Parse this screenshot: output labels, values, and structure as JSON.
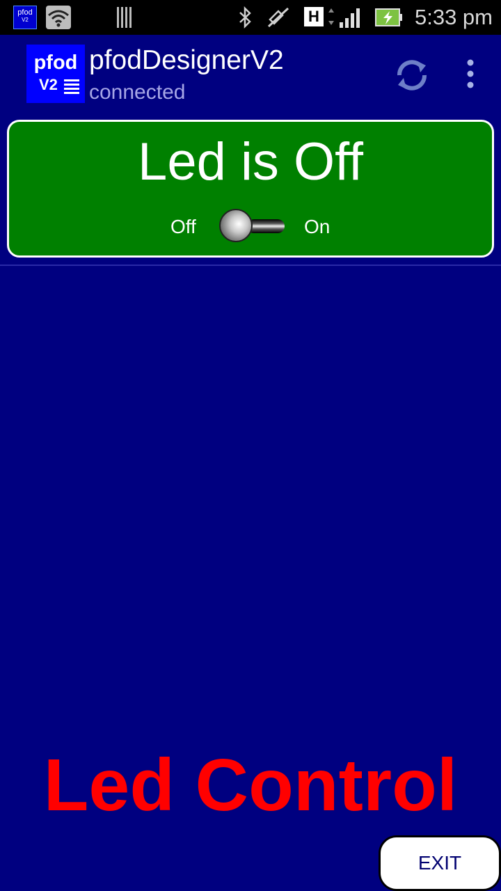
{
  "status_bar": {
    "notification_app_text": "pfod",
    "notification_app_subtext": "V2",
    "icons": [
      "pfod-app-icon",
      "wifi-icon",
      "barcode-icon",
      "bluetooth-icon",
      "vibrate-off-icon",
      "hspa-icon",
      "signal-icon",
      "battery-charging-icon"
    ],
    "network_type": "H",
    "time": "5:33 pm"
  },
  "action_bar": {
    "logo_text": "pfod",
    "logo_version": "V2",
    "title": "pfodDesignerV2",
    "subtitle": "connected",
    "refresh_icon": "refresh-icon",
    "overflow_icon": "overflow-menu-icon"
  },
  "led_card": {
    "status_text": "Led is Off",
    "toggle_off_label": "Off",
    "toggle_on_label": "On",
    "toggle_state": "off",
    "background_color": "#008000"
  },
  "footer": {
    "title": "Led Control",
    "title_color": "#ff0000"
  },
  "exit_button": {
    "label": "EXIT"
  },
  "colors": {
    "background": "#000080",
    "status_bar": "#000000",
    "accent": "#0000ff"
  }
}
